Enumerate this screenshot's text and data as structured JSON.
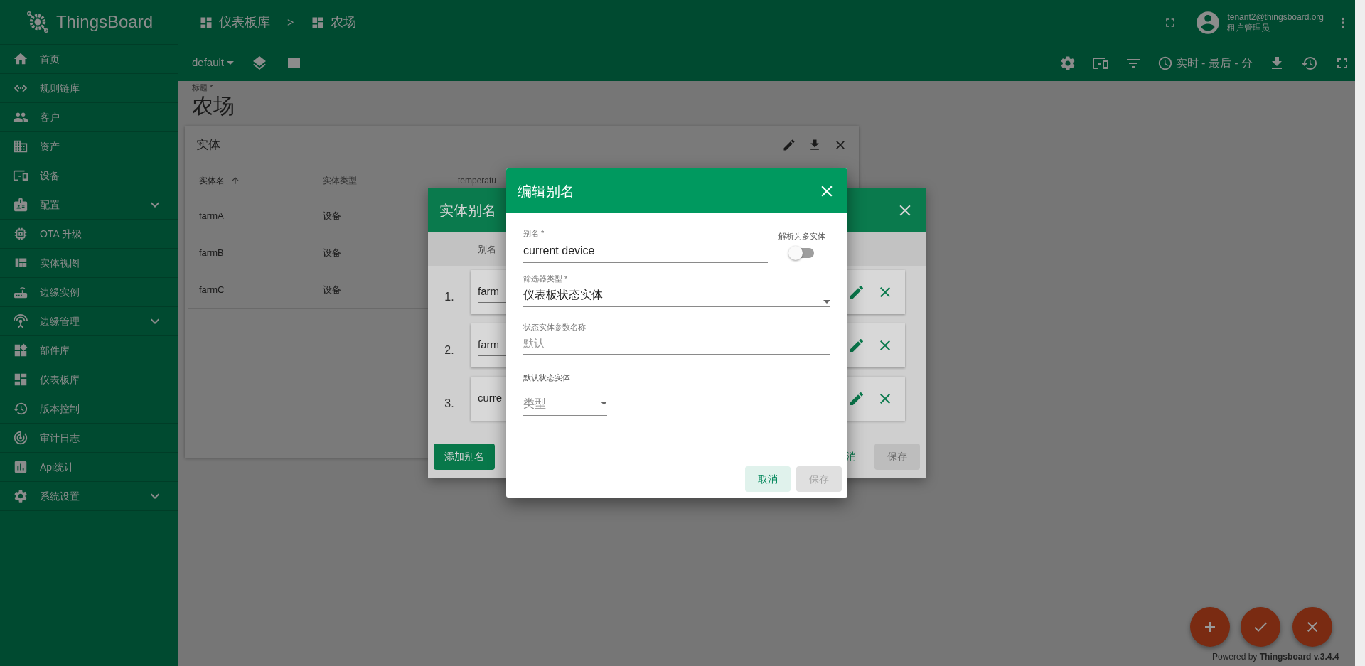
{
  "sidebar": {
    "logo": "ThingsBoard",
    "items": [
      {
        "label": "首页",
        "expandable": false
      },
      {
        "label": "规则链库",
        "expandable": false
      },
      {
        "label": "客户",
        "expandable": false
      },
      {
        "label": "资产",
        "expandable": false
      },
      {
        "label": "设备",
        "expandable": false
      },
      {
        "label": "配置",
        "expandable": true
      },
      {
        "label": "OTA 升级",
        "expandable": false
      },
      {
        "label": "实体视图",
        "expandable": false
      },
      {
        "label": "边缘实例",
        "expandable": false
      },
      {
        "label": "边缘管理",
        "expandable": true
      },
      {
        "label": "部件库",
        "expandable": false
      },
      {
        "label": "仪表板库",
        "expandable": false
      },
      {
        "label": "版本控制",
        "expandable": false
      },
      {
        "label": "审计日志",
        "expandable": false
      },
      {
        "label": "Api统计",
        "expandable": false
      },
      {
        "label": "系统设置",
        "expandable": true
      }
    ]
  },
  "breadcrumb": {
    "items": [
      "仪表板库",
      "农场"
    ],
    "separator": ">"
  },
  "user": {
    "email": "tenant2@thingsboard.org",
    "role": "租户管理员"
  },
  "toolbar": {
    "state": "default",
    "timewindow": "实时 - 最后 - 分"
  },
  "dashboard": {
    "title_label": "标题 *",
    "title": "农场"
  },
  "widget": {
    "title": "实体",
    "columns": [
      {
        "label": "实体名",
        "sorted": true
      },
      {
        "label": "实体类型",
        "sorted": false
      },
      {
        "label": "temperatu",
        "sorted": false
      }
    ],
    "rows": [
      [
        "farmA",
        "设备"
      ],
      [
        "farmB",
        "设备"
      ],
      [
        "farmC",
        "设备"
      ]
    ]
  },
  "alias_dialog": {
    "title": "实体别名",
    "column": "别名",
    "aliases": [
      {
        "index": "1.",
        "name": "farm"
      },
      {
        "index": "2.",
        "name": "farm"
      },
      {
        "index": "3.",
        "name": "curre"
      }
    ],
    "add_button": "添加别名",
    "cancel_button": "消",
    "save_button": "保存",
    "save_disabled": true
  },
  "edit_dialog": {
    "title": "编辑别名",
    "alias_label": "别名 *",
    "alias_value": "current device",
    "multiple_label": "解析为多实体",
    "multiple": false,
    "filter_label": "筛选器类型 *",
    "filter_value": "仪表板状态实体",
    "param_label": "状态实体参数名称",
    "param_placeholder": "默认",
    "default_label": "默认状态实体",
    "type_placeholder": "类型",
    "cancel_button": "取消",
    "save_button": "保存",
    "save_disabled": true
  },
  "footer": {
    "powered_by": "Powered by",
    "version": "Thingsboard v.3.4.4"
  }
}
